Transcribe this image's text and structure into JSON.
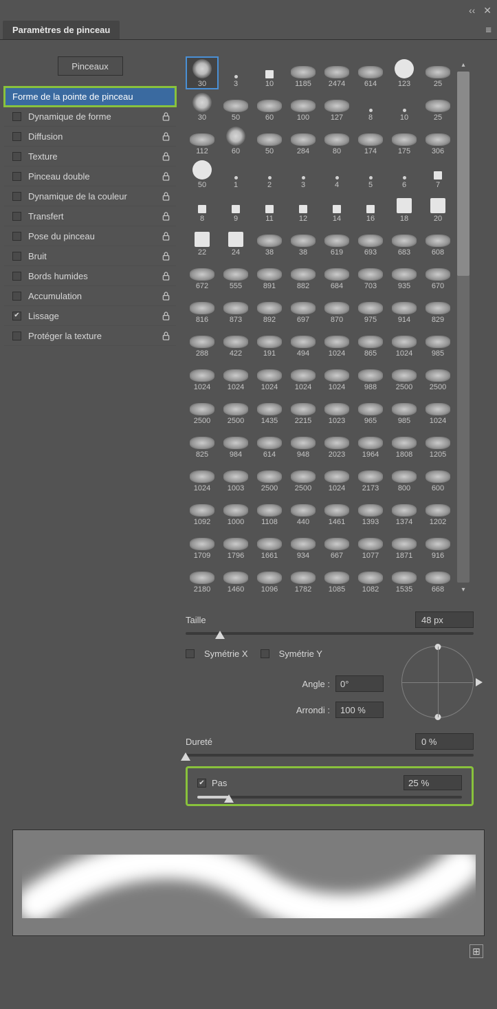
{
  "header": {
    "collapse": "‹‹",
    "close": "✕",
    "menu": "≡"
  },
  "tab_title": "Paramètres de pinceau",
  "brushes_button": "Pinceaux",
  "settings": [
    {
      "label": "Forme de la pointe de pinceau",
      "has_cb": false,
      "checked": false,
      "lock": false,
      "highlight": true
    },
    {
      "label": "Dynamique de forme",
      "has_cb": true,
      "checked": false,
      "lock": true
    },
    {
      "label": "Diffusion",
      "has_cb": true,
      "checked": false,
      "lock": true
    },
    {
      "label": "Texture",
      "has_cb": true,
      "checked": false,
      "lock": true
    },
    {
      "label": "Pinceau double",
      "has_cb": true,
      "checked": false,
      "lock": true
    },
    {
      "label": "Dynamique de la couleur",
      "has_cb": true,
      "checked": false,
      "lock": true
    },
    {
      "label": "Transfert",
      "has_cb": true,
      "checked": false,
      "lock": true
    },
    {
      "label": "Pose du pinceau",
      "has_cb": true,
      "checked": false,
      "lock": true
    },
    {
      "label": "Bruit",
      "has_cb": true,
      "checked": false,
      "lock": true
    },
    {
      "label": "Bords humides",
      "has_cb": true,
      "checked": false,
      "lock": true
    },
    {
      "label": "Accumulation",
      "has_cb": true,
      "checked": false,
      "lock": true
    },
    {
      "label": "Lissage",
      "has_cb": true,
      "checked": true,
      "lock": true
    },
    {
      "label": "Protéger la texture",
      "has_cb": true,
      "checked": false,
      "lock": true
    }
  ],
  "brushes": [
    [
      {
        "v": "30",
        "t": "soft",
        "sel": true
      },
      {
        "v": "3",
        "t": "dot"
      },
      {
        "v": "10",
        "t": "sq"
      },
      {
        "v": "1185",
        "t": "smudge"
      },
      {
        "v": "2474",
        "t": "smudge"
      },
      {
        "v": "614",
        "t": "smudge"
      },
      {
        "v": "123",
        "t": "white-circ"
      },
      {
        "v": "25",
        "t": "smudge"
      }
    ],
    [
      {
        "v": "30",
        "t": "soft"
      },
      {
        "v": "50",
        "t": "smudge"
      },
      {
        "v": "60",
        "t": "smudge"
      },
      {
        "v": "100",
        "t": "smudge"
      },
      {
        "v": "127",
        "t": "smudge"
      },
      {
        "v": "8",
        "t": "dot"
      },
      {
        "v": "10",
        "t": "dot"
      },
      {
        "v": "25",
        "t": "smudge"
      }
    ],
    [
      {
        "v": "112",
        "t": "smudge"
      },
      {
        "v": "60",
        "t": "soft"
      },
      {
        "v": "50",
        "t": "smudge"
      },
      {
        "v": "284",
        "t": "smudge"
      },
      {
        "v": "80",
        "t": "smudge"
      },
      {
        "v": "174",
        "t": "smudge"
      },
      {
        "v": "175",
        "t": "smudge"
      },
      {
        "v": "306",
        "t": "smudge"
      }
    ],
    [
      {
        "v": "50",
        "t": "white-circ"
      },
      {
        "v": "1",
        "t": "dot"
      },
      {
        "v": "2",
        "t": "dot"
      },
      {
        "v": "3",
        "t": "dot"
      },
      {
        "v": "4",
        "t": "dot"
      },
      {
        "v": "5",
        "t": "dot"
      },
      {
        "v": "6",
        "t": "dot"
      },
      {
        "v": "7",
        "t": "sq"
      }
    ],
    [
      {
        "v": "8",
        "t": "sq"
      },
      {
        "v": "9",
        "t": "sq"
      },
      {
        "v": "11",
        "t": "sq"
      },
      {
        "v": "12",
        "t": "sq"
      },
      {
        "v": "14",
        "t": "sq"
      },
      {
        "v": "16",
        "t": "sq"
      },
      {
        "v": "18",
        "t": "white-sq"
      },
      {
        "v": "20",
        "t": "white-sq"
      }
    ],
    [
      {
        "v": "22",
        "t": "white-sq"
      },
      {
        "v": "24",
        "t": "white-sq"
      },
      {
        "v": "38",
        "t": "smudge"
      },
      {
        "v": "38",
        "t": "smudge"
      },
      {
        "v": "619",
        "t": "smudge"
      },
      {
        "v": "693",
        "t": "smudge"
      },
      {
        "v": "683",
        "t": "smudge"
      },
      {
        "v": "608",
        "t": "smudge"
      }
    ],
    [
      {
        "v": "672",
        "t": "smudge"
      },
      {
        "v": "555",
        "t": "smudge"
      },
      {
        "v": "891",
        "t": "smudge"
      },
      {
        "v": "882",
        "t": "smudge"
      },
      {
        "v": "684",
        "t": "smudge"
      },
      {
        "v": "703",
        "t": "smudge"
      },
      {
        "v": "935",
        "t": "smudge"
      },
      {
        "v": "670",
        "t": "smudge"
      }
    ],
    [
      {
        "v": "816",
        "t": "smudge"
      },
      {
        "v": "873",
        "t": "smudge"
      },
      {
        "v": "892",
        "t": "smudge"
      },
      {
        "v": "697",
        "t": "smudge"
      },
      {
        "v": "870",
        "t": "smudge"
      },
      {
        "v": "975",
        "t": "smudge"
      },
      {
        "v": "914",
        "t": "smudge"
      },
      {
        "v": "829",
        "t": "smudge"
      }
    ],
    [
      {
        "v": "288",
        "t": "smudge"
      },
      {
        "v": "422",
        "t": "smudge"
      },
      {
        "v": "191",
        "t": "smudge"
      },
      {
        "v": "494",
        "t": "smudge"
      },
      {
        "v": "1024",
        "t": "smudge"
      },
      {
        "v": "865",
        "t": "smudge"
      },
      {
        "v": "1024",
        "t": "smudge"
      },
      {
        "v": "985",
        "t": "smudge"
      }
    ],
    [
      {
        "v": "1024",
        "t": "smudge"
      },
      {
        "v": "1024",
        "t": "smudge"
      },
      {
        "v": "1024",
        "t": "smudge"
      },
      {
        "v": "1024",
        "t": "smudge"
      },
      {
        "v": "1024",
        "t": "smudge"
      },
      {
        "v": "988",
        "t": "smudge"
      },
      {
        "v": "2500",
        "t": "smudge"
      },
      {
        "v": "2500",
        "t": "smudge"
      }
    ],
    [
      {
        "v": "2500",
        "t": "smudge"
      },
      {
        "v": "2500",
        "t": "smudge"
      },
      {
        "v": "1435",
        "t": "smudge"
      },
      {
        "v": "2215",
        "t": "smudge"
      },
      {
        "v": "1023",
        "t": "smudge"
      },
      {
        "v": "965",
        "t": "smudge"
      },
      {
        "v": "985",
        "t": "smudge"
      },
      {
        "v": "1024",
        "t": "smudge"
      }
    ],
    [
      {
        "v": "825",
        "t": "smudge"
      },
      {
        "v": "984",
        "t": "smudge"
      },
      {
        "v": "614",
        "t": "smudge"
      },
      {
        "v": "948",
        "t": "smudge"
      },
      {
        "v": "2023",
        "t": "smudge"
      },
      {
        "v": "1964",
        "t": "smudge"
      },
      {
        "v": "1808",
        "t": "smudge"
      },
      {
        "v": "1205",
        "t": "smudge"
      }
    ],
    [
      {
        "v": "1024",
        "t": "smudge"
      },
      {
        "v": "1003",
        "t": "smudge"
      },
      {
        "v": "2500",
        "t": "smudge"
      },
      {
        "v": "2500",
        "t": "smudge"
      },
      {
        "v": "1024",
        "t": "smudge"
      },
      {
        "v": "2173",
        "t": "smudge"
      },
      {
        "v": "800",
        "t": "smudge"
      },
      {
        "v": "600",
        "t": "smudge"
      }
    ],
    [
      {
        "v": "1092",
        "t": "smudge"
      },
      {
        "v": "1000",
        "t": "smudge"
      },
      {
        "v": "1108",
        "t": "smudge"
      },
      {
        "v": "440",
        "t": "smudge"
      },
      {
        "v": "1461",
        "t": "smudge"
      },
      {
        "v": "1393",
        "t": "smudge"
      },
      {
        "v": "1374",
        "t": "smudge"
      },
      {
        "v": "1202",
        "t": "smudge"
      }
    ],
    [
      {
        "v": "1709",
        "t": "smudge"
      },
      {
        "v": "1796",
        "t": "smudge"
      },
      {
        "v": "1661",
        "t": "smudge"
      },
      {
        "v": "934",
        "t": "smudge"
      },
      {
        "v": "667",
        "t": "smudge"
      },
      {
        "v": "1077",
        "t": "smudge"
      },
      {
        "v": "1871",
        "t": "smudge"
      },
      {
        "v": "916",
        "t": "smudge"
      }
    ],
    [
      {
        "v": "2180",
        "t": "smudge"
      },
      {
        "v": "1460",
        "t": "smudge"
      },
      {
        "v": "1096",
        "t": "smudge"
      },
      {
        "v": "1782",
        "t": "smudge"
      },
      {
        "v": "1085",
        "t": "smudge"
      },
      {
        "v": "1082",
        "t": "smudge"
      },
      {
        "v": "1535",
        "t": "smudge"
      },
      {
        "v": "668",
        "t": "smudge"
      }
    ]
  ],
  "size": {
    "label": "Taille",
    "value": "48 px",
    "percent": 12
  },
  "flipX": "Symétrie X",
  "flipY": "Symétrie Y",
  "angle": {
    "label": "Angle :",
    "value": "0°"
  },
  "roundness": {
    "label": "Arrondi :",
    "value": "100 %"
  },
  "hardness": {
    "label": "Dureté",
    "value": "0 %",
    "percent": 0
  },
  "spacing": {
    "label": "Pas",
    "value": "25 %",
    "percent": 12,
    "checked": true
  },
  "footer": {
    "new": "⊞"
  }
}
